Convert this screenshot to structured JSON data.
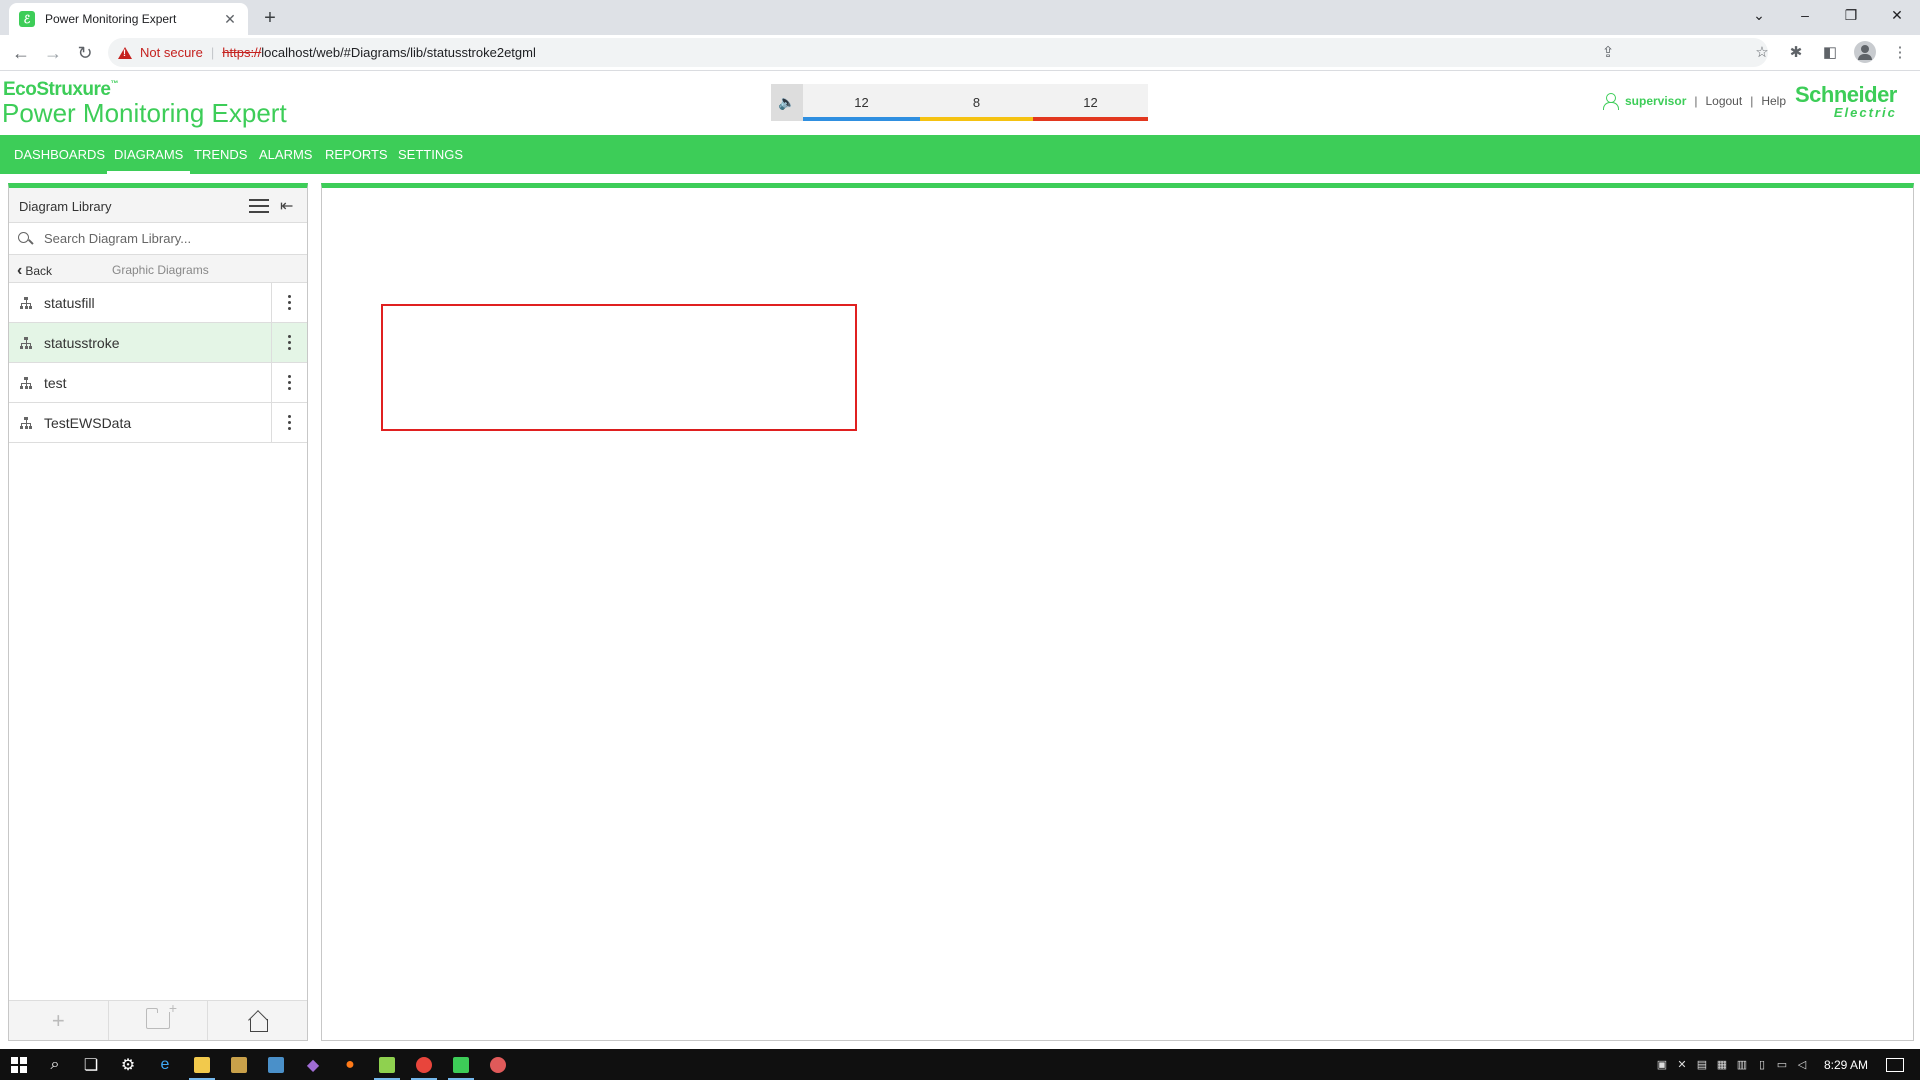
{
  "browser": {
    "tab_title": "Power Monitoring Expert",
    "favicon_glyph": "ℰ",
    "new_tab": "+",
    "close_tab": "✕",
    "security_label": "Not secure",
    "url_scheme": "https://",
    "url_rest": "localhost/web/#Diagrams/lib/statusstroke2etgml",
    "window_controls": {
      "chevron": "⌄",
      "minimize": "–",
      "restore": "❐",
      "close": "✕"
    },
    "nav_icons": {
      "back": "←",
      "forward": "→",
      "reload": "↻"
    }
  },
  "app": {
    "brand_line1": "EcoStruxure",
    "brand_tm": "™",
    "brand_line2": "Power Monitoring Expert",
    "alarms": [
      {
        "count": "12",
        "color": "#2f8fe0"
      },
      {
        "count": "8",
        "color": "#f5c211"
      },
      {
        "count": "12",
        "color": "#e2371f"
      }
    ],
    "user": {
      "name": "supervisor",
      "logout": "Logout",
      "help": "Help",
      "separator": "|"
    },
    "vendor_logo_line1": "Schneider",
    "vendor_logo_line2": "Electric",
    "accent_color": "#3dcd58"
  },
  "nav": {
    "items": [
      "DASHBOARDS",
      "DIAGRAMS",
      "TRENDS",
      "ALARMS",
      "REPORTS",
      "SETTINGS"
    ],
    "active": "DIAGRAMS"
  },
  "sidebar": {
    "title": "Diagram Library",
    "search_placeholder": "Search Diagram Library...",
    "back_label": "Back",
    "back_chevron": "‹",
    "folder_title": "Graphic Diagrams",
    "items": [
      {
        "label": "statusfill",
        "selected": false
      },
      {
        "label": "statusstroke",
        "selected": true
      },
      {
        "label": "test",
        "selected": false
      },
      {
        "label": "TestEWSData",
        "selected": false
      }
    ],
    "footer": {
      "add": "+"
    }
  },
  "canvas": {
    "shape_stroke_color": "#e02020"
  },
  "taskbar": {
    "time": "8:29 AM"
  }
}
